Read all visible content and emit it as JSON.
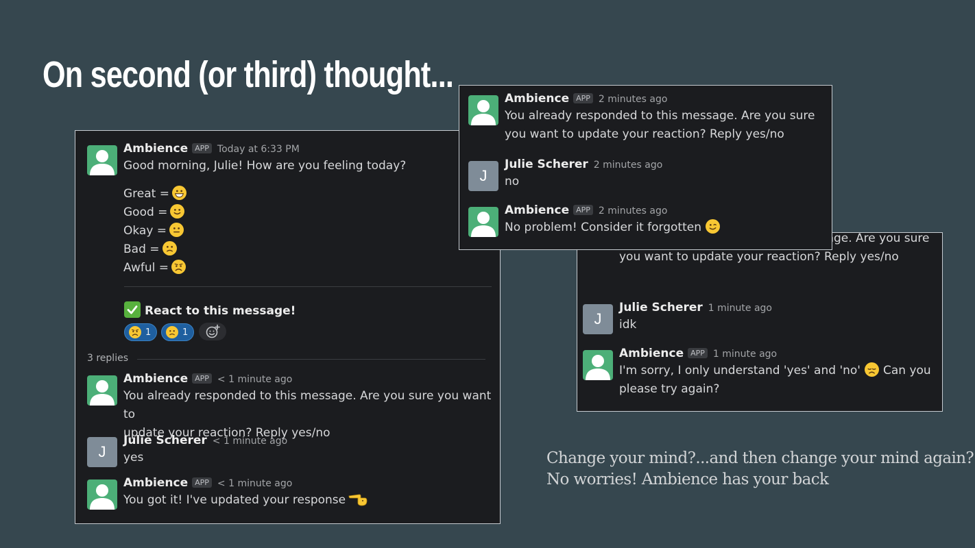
{
  "slide": {
    "title": "On second (or third) thought...",
    "caption_line1": "Change your mind?...and then change your mind again?",
    "caption_line2": "No worries! Ambience has your back"
  },
  "main_thread": {
    "parent": {
      "user": "Ambience",
      "badge": "APP",
      "time": "Today at 6:33 PM",
      "text": "Good morning, Julie! How are you feeling today?",
      "options": [
        {
          "label": "Great =",
          "emoji": "grinning-face-icon"
        },
        {
          "label": "Good =",
          "emoji": "slightly-smiling-face-icon"
        },
        {
          "label": "Okay =",
          "emoji": "neutral-face-icon"
        },
        {
          "label": "Bad =",
          "emoji": "slightly-frowning-face-icon"
        },
        {
          "label": "Awful =",
          "emoji": "frowning-face-icon"
        }
      ],
      "react_prompt": "React to this message!",
      "reactions": [
        {
          "emoji": "frowning-face-icon",
          "count": "1"
        },
        {
          "emoji": "slightly-frowning-face-icon",
          "count": "1"
        }
      ]
    },
    "replies_label": "3 replies",
    "replies": [
      {
        "user": "Ambience",
        "badge": "APP",
        "time": "< 1 minute ago",
        "line1": "You already responded to this message. Are you sure you want to",
        "line2": "update your reaction? Reply yes/no"
      },
      {
        "user": "Julie Scherer",
        "avatar_letter": "J",
        "time": "< 1 minute ago",
        "line1": "yes"
      },
      {
        "user": "Ambience",
        "badge": "APP",
        "time": "< 1 minute ago",
        "line1": "You got it! I've updated your response",
        "emoji": "saluting-hand-icon"
      }
    ]
  },
  "top_thread": {
    "messages": [
      {
        "user": "Ambience",
        "badge": "APP",
        "time": "2 minutes ago",
        "line1": "You already responded to this message. Are you sure",
        "line2": "you want to update your reaction? Reply yes/no"
      },
      {
        "user": "Julie Scherer",
        "avatar_letter": "J",
        "time": "2 minutes ago",
        "line1": "no"
      },
      {
        "user": "Ambience",
        "badge": "APP",
        "time": "2 minutes ago",
        "line1": "No problem! Consider it forgotten",
        "emoji": "winking-face-icon"
      }
    ]
  },
  "bottom_thread": {
    "messages": [
      {
        "line1": "You already responded to this message. Are you sure",
        "line2": "you want to update your reaction? Reply yes/no"
      },
      {
        "user": "Julie Scherer",
        "avatar_letter": "J",
        "time": "1 minute ago",
        "line1": "idk"
      },
      {
        "user": "Ambience",
        "badge": "APP",
        "time": "1 minute ago",
        "line1": "I'm sorry, I only understand 'yes' and 'no'",
        "emoji": "disappointed-face-icon",
        "line1_after": "Can you",
        "line2": "please try again?"
      }
    ]
  },
  "colors": {
    "slide_background": "#36474f",
    "panel_background": "#1b1c1f",
    "bot_avatar": "#4caf78",
    "user_avatar": "#7f8c98",
    "reaction_pill": "#1f5f9f",
    "emoji_yellow": "#f8c733"
  }
}
